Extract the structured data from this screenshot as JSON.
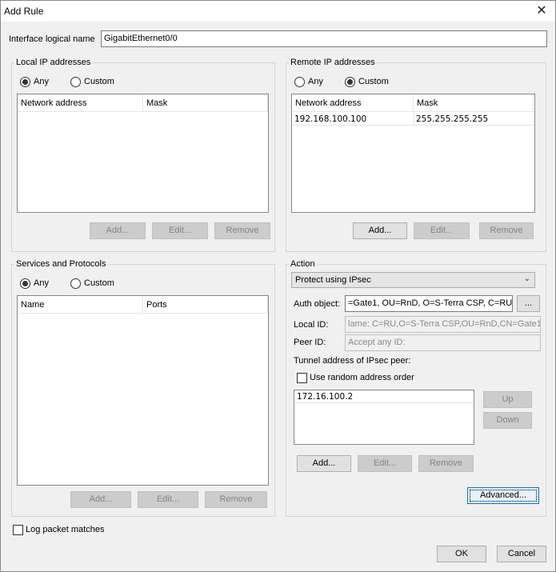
{
  "window": {
    "title": "Add Rule",
    "close_glyph": "✕"
  },
  "interface": {
    "label": "Interface logical name",
    "value": "GigabitEthernet0/0"
  },
  "local_ip": {
    "group_label": "Local IP addresses",
    "any_label": "Any",
    "custom_label": "Custom",
    "selected": "Any",
    "columns": [
      "Network address",
      "Mask"
    ],
    "rows": [],
    "buttons": {
      "add": "Add...",
      "edit": "Edit...",
      "remove": "Remove"
    }
  },
  "remote_ip": {
    "group_label": "Remote IP addresses",
    "any_label": "Any",
    "custom_label": "Custom",
    "selected": "Custom",
    "columns": [
      "Network address",
      "Mask"
    ],
    "rows": [
      {
        "network": "192.168.100.100",
        "mask": "255.255.255.255"
      }
    ],
    "buttons": {
      "add": "Add...",
      "edit": "Edit...",
      "remove": "Remove"
    }
  },
  "services": {
    "group_label": "Services and Protocols",
    "any_label": "Any",
    "custom_label": "Custom",
    "selected": "Any",
    "columns": [
      "Name",
      "Ports"
    ],
    "rows": [],
    "buttons": {
      "add": "Add...",
      "edit": "Edit...",
      "remove": "Remove"
    }
  },
  "action": {
    "group_label": "Action",
    "mode": "Protect using IPsec",
    "auth_label": "Auth object:",
    "auth_value": "=Gate1, OU=RnD, O=S-Terra CSP, C=RU",
    "browse_label": "...",
    "local_id_label": "Local ID:",
    "local_id_value": "lame: C=RU,O=S-Terra CSP,OU=RnD,CN=Gate1",
    "peer_id_label": "Peer ID:",
    "peer_id_value": "Accept any ID:",
    "tunnel_label": "Tunnel address of IPsec peer:",
    "random_order_label": "Use random address order",
    "tunnel_addresses": [
      "172.16.100.2"
    ],
    "buttons": {
      "up": "Up",
      "down": "Down",
      "add": "Add...",
      "edit": "Edit...",
      "remove": "Remove",
      "advanced": "Advanced..."
    }
  },
  "log_label": "Log packet matches",
  "footer": {
    "ok": "OK",
    "cancel": "Cancel"
  }
}
